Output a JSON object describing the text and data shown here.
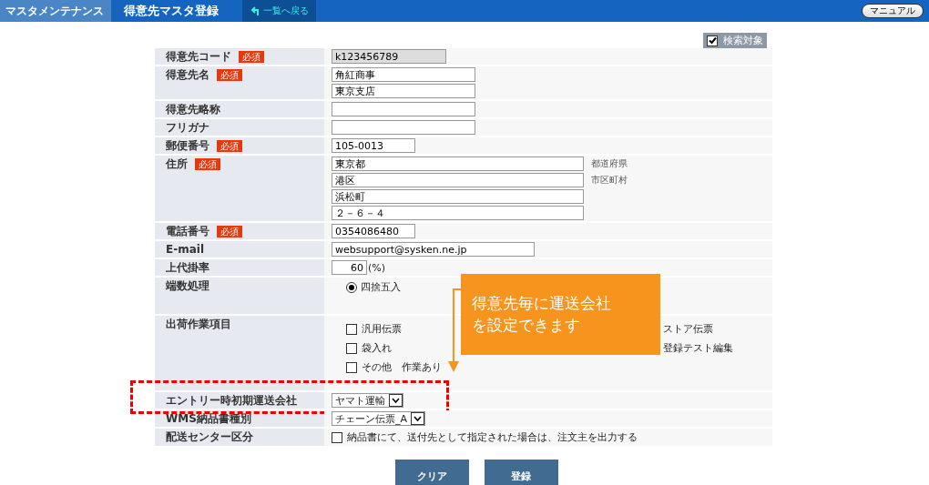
{
  "header": {
    "section": "マスタメンテナンス",
    "title": "得意先マスタ登録",
    "back_link": "一覧へ戻る",
    "manual_button": "マニュアル"
  },
  "search_target": {
    "label": "検索対象",
    "checked": true
  },
  "rows": [
    {
      "label": "得意先コード",
      "badge": "必須",
      "kind": "code",
      "values": [
        "k123456789"
      ]
    },
    {
      "label": "得意先名",
      "badge": "必須",
      "kind": "text",
      "values": [
        "角紅商事",
        "東京支店"
      ]
    },
    {
      "label": "得意先略称",
      "kind": "blank"
    },
    {
      "label": "フリガナ",
      "kind": "blank"
    },
    {
      "label": "郵便番号",
      "badge": "必須",
      "kind": "zip",
      "values": [
        "105-0013"
      ]
    },
    {
      "label": "住所",
      "badge": "必須",
      "kind": "address",
      "lines": [
        {
          "value": "東京都",
          "note": "都道府県"
        },
        {
          "value": "港区",
          "note": "市区町村"
        },
        {
          "value": "浜松町"
        },
        {
          "value": "２－６－４"
        }
      ]
    },
    {
      "label": "電話番号",
      "badge": "必須",
      "kind": "zip",
      "values": [
        "0354086480"
      ]
    },
    {
      "label": "E-mail",
      "kind": "email",
      "values": [
        "websupport@sysken.ne.jp"
      ]
    },
    {
      "label": "上代掛率",
      "kind": "rate",
      "values": [
        "60"
      ],
      "unit": "(%)"
    },
    {
      "label": "端数処理",
      "kind": "radio",
      "options": [
        {
          "label": "四捨五入",
          "selected": true
        }
      ]
    },
    {
      "label": "出荷作業項目",
      "kind": "checks",
      "options": [
        {
          "label": "汎用伝票",
          "checked": false
        },
        {
          "label": "袋入れ",
          "checked": false
        },
        {
          "label": "その他　作業あり",
          "checked": false
        }
      ],
      "partial": [
        "ストア伝票",
        "登録テスト編集"
      ]
    },
    {
      "label": "エントリー時初期運送会社",
      "kind": "select",
      "value": "ヤマト運輸",
      "highlighted": true
    },
    {
      "label": "WMS納品書種別",
      "kind": "select",
      "value": "チェーン伝票_A"
    },
    {
      "label": "配送センター区分",
      "kind": "checkbox",
      "option": {
        "label": "納品書にて、送付先として指定された場合は、注文主を出力する",
        "checked": false
      }
    }
  ],
  "callout": {
    "lines": [
      "得意先毎に運送会社",
      "を設定できます"
    ]
  },
  "buttons": [
    "クリア",
    "登録"
  ]
}
